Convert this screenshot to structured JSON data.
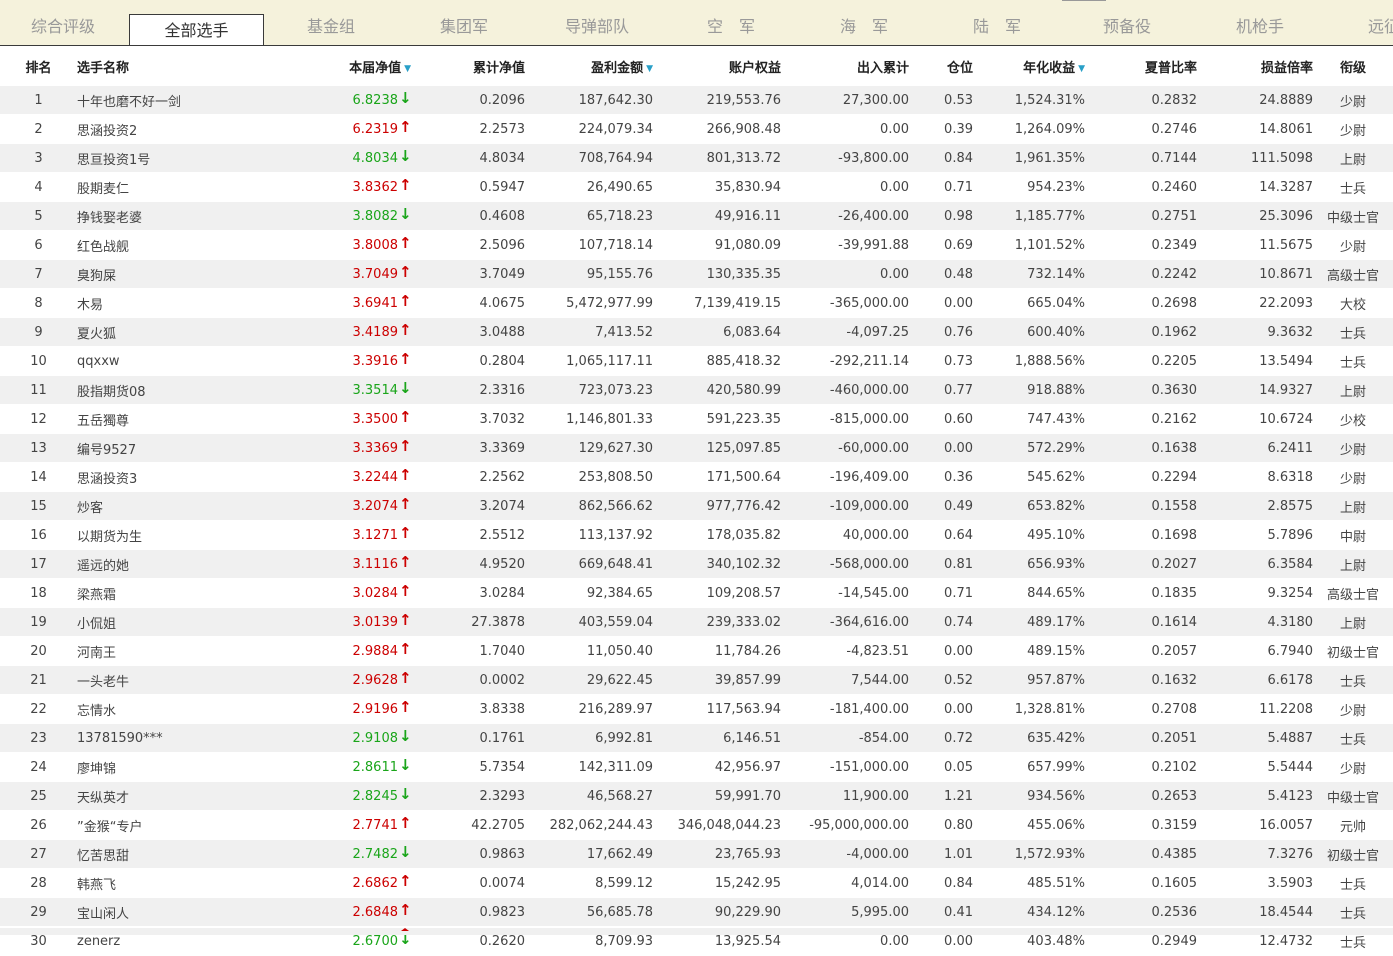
{
  "tabs": [
    {
      "label": "综合评级",
      "active": false
    },
    {
      "label": "全部选手",
      "active": true
    },
    {
      "label": "基金组",
      "active": false
    },
    {
      "label": "集团军",
      "active": false
    },
    {
      "label": "导弹部队",
      "active": false
    },
    {
      "label": "空　军",
      "active": false
    },
    {
      "label": "海　军",
      "active": false
    },
    {
      "label": "陆　军",
      "active": false
    },
    {
      "label": "预备役",
      "active": false
    },
    {
      "label": "机枪手",
      "active": false
    },
    {
      "label": "远征",
      "active": false
    }
  ],
  "columns": [
    {
      "label": "排名",
      "sortable": false
    },
    {
      "label": "选手名称",
      "sortable": false
    },
    {
      "label": "本届净值",
      "sortable": true
    },
    {
      "label": "累计净值",
      "sortable": false
    },
    {
      "label": "盈利金额",
      "sortable": true
    },
    {
      "label": "账户权益",
      "sortable": false
    },
    {
      "label": "出入累计",
      "sortable": false
    },
    {
      "label": "仓位",
      "sortable": false
    },
    {
      "label": "年化收益",
      "sortable": true
    },
    {
      "label": "夏普比率",
      "sortable": false
    },
    {
      "label": "损益倍率",
      "sortable": false
    },
    {
      "label": "衔级",
      "sortable": false
    }
  ],
  "colors": {
    "up": "#cc0000",
    "down": "#1aa51a",
    "sort_indicator": "#29a0c8",
    "tab_bar_bg": "#f5f2dc"
  },
  "rows": [
    {
      "rank": "1",
      "name": "十年也磨不好一剑",
      "nav": "6.8238",
      "trend": "down",
      "cum_nav": "0.2096",
      "profit": "187,642.30",
      "equity": "219,553.76",
      "flow": "27,300.00",
      "position": "0.53",
      "annual": "1,524.31%",
      "sharpe": "0.2832",
      "pl_ratio": "24.8889",
      "title": "少尉"
    },
    {
      "rank": "2",
      "name": "思涵投资2",
      "nav": "6.2319",
      "trend": "up",
      "cum_nav": "2.2573",
      "profit": "224,079.34",
      "equity": "266,908.48",
      "flow": "0.00",
      "position": "0.39",
      "annual": "1,264.09%",
      "sharpe": "0.2746",
      "pl_ratio": "14.8061",
      "title": "少尉"
    },
    {
      "rank": "3",
      "name": "思亘投资1号",
      "nav": "4.8034",
      "trend": "down",
      "cum_nav": "4.8034",
      "profit": "708,764.94",
      "equity": "801,313.72",
      "flow": "-93,800.00",
      "position": "0.84",
      "annual": "1,961.35%",
      "sharpe": "0.7144",
      "pl_ratio": "111.5098",
      "title": "上尉"
    },
    {
      "rank": "4",
      "name": "股期麦仁",
      "nav": "3.8362",
      "trend": "up",
      "cum_nav": "0.5947",
      "profit": "26,490.65",
      "equity": "35,830.94",
      "flow": "0.00",
      "position": "0.71",
      "annual": "954.23%",
      "sharpe": "0.2460",
      "pl_ratio": "14.3287",
      "title": "士兵"
    },
    {
      "rank": "5",
      "name": "挣钱娶老婆",
      "nav": "3.8082",
      "trend": "down",
      "cum_nav": "0.4608",
      "profit": "65,718.23",
      "equity": "49,916.11",
      "flow": "-26,400.00",
      "position": "0.98",
      "annual": "1,185.77%",
      "sharpe": "0.2751",
      "pl_ratio": "25.3096",
      "title": "中级士官"
    },
    {
      "rank": "6",
      "name": "红色战舰",
      "nav": "3.8008",
      "trend": "up",
      "cum_nav": "2.5096",
      "profit": "107,718.14",
      "equity": "91,080.09",
      "flow": "-39,991.88",
      "position": "0.69",
      "annual": "1,101.52%",
      "sharpe": "0.2349",
      "pl_ratio": "11.5675",
      "title": "少尉"
    },
    {
      "rank": "7",
      "name": "臭狗屎",
      "nav": "3.7049",
      "trend": "up",
      "cum_nav": "3.7049",
      "profit": "95,155.76",
      "equity": "130,335.35",
      "flow": "0.00",
      "position": "0.48",
      "annual": "732.14%",
      "sharpe": "0.2242",
      "pl_ratio": "10.8671",
      "title": "高级士官"
    },
    {
      "rank": "8",
      "name": "木易",
      "nav": "3.6941",
      "trend": "up",
      "cum_nav": "4.0675",
      "profit": "5,472,977.99",
      "equity": "7,139,419.15",
      "flow": "-365,000.00",
      "position": "0.00",
      "annual": "665.04%",
      "sharpe": "0.2698",
      "pl_ratio": "22.2093",
      "title": "大校"
    },
    {
      "rank": "9",
      "name": "夏火狐",
      "nav": "3.4189",
      "trend": "up",
      "cum_nav": "3.0488",
      "profit": "7,413.52",
      "equity": "6,083.64",
      "flow": "-4,097.25",
      "position": "0.76",
      "annual": "600.40%",
      "sharpe": "0.1962",
      "pl_ratio": "9.3632",
      "title": "士兵"
    },
    {
      "rank": "10",
      "name": "qqxxw",
      "nav": "3.3916",
      "trend": "up",
      "cum_nav": "0.2804",
      "profit": "1,065,117.11",
      "equity": "885,418.32",
      "flow": "-292,211.14",
      "position": "0.73",
      "annual": "1,888.56%",
      "sharpe": "0.2205",
      "pl_ratio": "13.5494",
      "title": "士兵"
    },
    {
      "rank": "11",
      "name": "股指期货08",
      "nav": "3.3514",
      "trend": "down",
      "cum_nav": "2.3316",
      "profit": "723,073.23",
      "equity": "420,580.99",
      "flow": "-460,000.00",
      "position": "0.77",
      "annual": "918.88%",
      "sharpe": "0.3630",
      "pl_ratio": "14.9327",
      "title": "上尉"
    },
    {
      "rank": "12",
      "name": "五岳獨尊",
      "nav": "3.3500",
      "trend": "up",
      "cum_nav": "3.7032",
      "profit": "1,146,801.33",
      "equity": "591,223.35",
      "flow": "-815,000.00",
      "position": "0.60",
      "annual": "747.43%",
      "sharpe": "0.2162",
      "pl_ratio": "10.6724",
      "title": "少校"
    },
    {
      "rank": "13",
      "name": "编号9527",
      "nav": "3.3369",
      "trend": "up",
      "cum_nav": "3.3369",
      "profit": "129,627.30",
      "equity": "125,097.85",
      "flow": "-60,000.00",
      "position": "0.00",
      "annual": "572.29%",
      "sharpe": "0.1638",
      "pl_ratio": "6.2411",
      "title": "少尉"
    },
    {
      "rank": "14",
      "name": "思涵投资3",
      "nav": "3.2244",
      "trend": "up",
      "cum_nav": "2.2562",
      "profit": "253,808.50",
      "equity": "171,500.64",
      "flow": "-196,409.00",
      "position": "0.36",
      "annual": "545.62%",
      "sharpe": "0.2294",
      "pl_ratio": "8.6318",
      "title": "少尉"
    },
    {
      "rank": "15",
      "name": "炒客",
      "nav": "3.2074",
      "trend": "up",
      "cum_nav": "3.2074",
      "profit": "862,566.62",
      "equity": "977,776.42",
      "flow": "-109,000.00",
      "position": "0.49",
      "annual": "653.82%",
      "sharpe": "0.1558",
      "pl_ratio": "2.8575",
      "title": "上尉"
    },
    {
      "rank": "16",
      "name": "以期货为生",
      "nav": "3.1271",
      "trend": "up",
      "cum_nav": "2.5512",
      "profit": "113,137.92",
      "equity": "178,035.82",
      "flow": "40,000.00",
      "position": "0.64",
      "annual": "495.10%",
      "sharpe": "0.1698",
      "pl_ratio": "5.7896",
      "title": "中尉"
    },
    {
      "rank": "17",
      "name": "遥远的她",
      "nav": "3.1116",
      "trend": "up",
      "cum_nav": "4.9520",
      "profit": "669,648.41",
      "equity": "340,102.32",
      "flow": "-568,000.00",
      "position": "0.81",
      "annual": "656.93%",
      "sharpe": "0.2027",
      "pl_ratio": "6.3584",
      "title": "上尉"
    },
    {
      "rank": "18",
      "name": "梁燕霜",
      "nav": "3.0284",
      "trend": "up",
      "cum_nav": "3.0284",
      "profit": "92,384.65",
      "equity": "109,208.57",
      "flow": "-14,545.00",
      "position": "0.71",
      "annual": "844.65%",
      "sharpe": "0.1835",
      "pl_ratio": "9.3254",
      "title": "高级士官"
    },
    {
      "rank": "19",
      "name": "小侃姐",
      "nav": "3.0139",
      "trend": "up",
      "cum_nav": "27.3878",
      "profit": "403,559.04",
      "equity": "239,333.02",
      "flow": "-364,616.00",
      "position": "0.74",
      "annual": "489.17%",
      "sharpe": "0.1614",
      "pl_ratio": "4.3180",
      "title": "上尉"
    },
    {
      "rank": "20",
      "name": "河南王",
      "nav": "2.9884",
      "trend": "up",
      "cum_nav": "1.7040",
      "profit": "11,050.40",
      "equity": "11,784.26",
      "flow": "-4,823.51",
      "position": "0.00",
      "annual": "489.15%",
      "sharpe": "0.2057",
      "pl_ratio": "6.7940",
      "title": "初级士官"
    },
    {
      "rank": "21",
      "name": "一头老牛",
      "nav": "2.9628",
      "trend": "up",
      "cum_nav": "0.0002",
      "profit": "29,622.45",
      "equity": "39,857.99",
      "flow": "7,544.00",
      "position": "0.52",
      "annual": "957.87%",
      "sharpe": "0.1632",
      "pl_ratio": "6.6178",
      "title": "士兵"
    },
    {
      "rank": "22",
      "name": "忘情水",
      "nav": "2.9196",
      "trend": "up",
      "cum_nav": "3.8338",
      "profit": "216,289.97",
      "equity": "117,563.94",
      "flow": "-181,400.00",
      "position": "0.00",
      "annual": "1,328.81%",
      "sharpe": "0.2708",
      "pl_ratio": "11.2208",
      "title": "少尉"
    },
    {
      "rank": "23",
      "name": "13781590***",
      "nav": "2.9108",
      "trend": "down",
      "cum_nav": "0.1761",
      "profit": "6,992.81",
      "equity": "6,146.51",
      "flow": "-854.00",
      "position": "0.72",
      "annual": "635.42%",
      "sharpe": "0.2051",
      "pl_ratio": "5.4887",
      "title": "士兵"
    },
    {
      "rank": "24",
      "name": "廖坤锦",
      "nav": "2.8611",
      "trend": "down",
      "cum_nav": "5.7354",
      "profit": "142,311.09",
      "equity": "42,956.97",
      "flow": "-151,000.00",
      "position": "0.05",
      "annual": "657.99%",
      "sharpe": "0.2102",
      "pl_ratio": "5.5444",
      "title": "少尉"
    },
    {
      "rank": "25",
      "name": "天纵英才",
      "nav": "2.8245",
      "trend": "down",
      "cum_nav": "2.3293",
      "profit": "46,568.27",
      "equity": "59,991.70",
      "flow": "11,900.00",
      "position": "1.21",
      "annual": "934.56%",
      "sharpe": "0.2653",
      "pl_ratio": "5.4123",
      "title": "中级士官"
    },
    {
      "rank": "26",
      "name": "”金猴“专户",
      "nav": "2.7741",
      "trend": "up",
      "cum_nav": "42.2705",
      "profit": "282,062,244.43",
      "equity": "346,048,044.23",
      "flow": "-95,000,000.00",
      "position": "0.80",
      "annual": "455.06%",
      "sharpe": "0.3159",
      "pl_ratio": "16.0057",
      "title": "元帅"
    },
    {
      "rank": "27",
      "name": "忆苦思甜",
      "nav": "2.7482",
      "trend": "down",
      "cum_nav": "0.9863",
      "profit": "17,662.49",
      "equity": "23,765.93",
      "flow": "-4,000.00",
      "position": "1.01",
      "annual": "1,572.93%",
      "sharpe": "0.4385",
      "pl_ratio": "7.3276",
      "title": "初级士官"
    },
    {
      "rank": "28",
      "name": "韩燕飞",
      "nav": "2.6862",
      "trend": "up",
      "cum_nav": "0.0074",
      "profit": "8,599.12",
      "equity": "15,242.95",
      "flow": "4,014.00",
      "position": "0.84",
      "annual": "485.51%",
      "sharpe": "0.1605",
      "pl_ratio": "3.5903",
      "title": "士兵"
    },
    {
      "rank": "29",
      "name": "宝山闲人",
      "nav": "2.6848",
      "trend": "up",
      "cum_nav": "0.9823",
      "profit": "56,685.78",
      "equity": "90,229.90",
      "flow": "5,995.00",
      "position": "0.41",
      "annual": "434.12%",
      "sharpe": "0.2536",
      "pl_ratio": "18.4544",
      "title": "士兵"
    },
    {
      "rank": "30",
      "name": "zenerz",
      "nav": "2.6700",
      "trend": "down",
      "cum_nav": "0.2620",
      "profit": "8,709.93",
      "equity": "13,925.54",
      "flow": "0.00",
      "position": "0.00",
      "annual": "403.48%",
      "sharpe": "0.2949",
      "pl_ratio": "12.4732",
      "title": "士兵"
    }
  ]
}
